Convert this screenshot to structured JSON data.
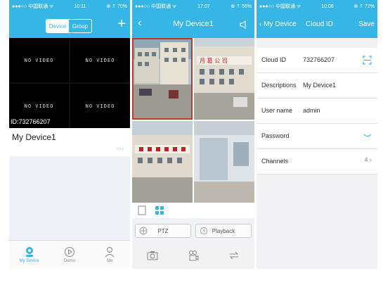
{
  "screen1": {
    "status": {
      "carrier": "●●●○○ 中国联通 ᯤ",
      "time": "10:11",
      "battery": "⊕ ⇡ 70%"
    },
    "segment": {
      "device": "Device",
      "group": "Group"
    },
    "add_icon": "+",
    "cells": [
      "NO VIDEO",
      "NO VIDEO",
      "NO VIDEO",
      "NO VIDEO"
    ],
    "device_id": "ID:732766207",
    "device_name": "My Device1",
    "more": "...",
    "tabs": [
      {
        "label": "My Device",
        "icon": "device-icon"
      },
      {
        "label": "Demo",
        "icon": "play-icon"
      },
      {
        "label": "Me",
        "icon": "person-icon"
      }
    ],
    "accent": "#35b6e6"
  },
  "screen2": {
    "status": {
      "carrier": "●●●○○ 中国联通 ᯤ",
      "time": "17:07",
      "battery": "⊕ ⇡ 56%"
    },
    "title": "My Device1",
    "back": "‹",
    "sign": "月 葛 公 司",
    "ptz": "PTZ",
    "playback": "Playback"
  },
  "screen3": {
    "status": {
      "carrier": "●●●○○ 中国联通 ᯤ",
      "time": "10:06",
      "battery": "⊕ ⇡ 72%"
    },
    "back": "‹ My Device",
    "title": "Cloud ID",
    "save": "Save",
    "rows": [
      {
        "label": "Cloud ID",
        "value": "732766207"
      },
      {
        "label": "Descriptions",
        "value": "My Device1"
      },
      {
        "label": "User name",
        "value": "admin"
      },
      {
        "label": "Password",
        "value": ""
      },
      {
        "label": "Channels",
        "value": ""
      }
    ],
    "channels_count": "4 ›"
  }
}
